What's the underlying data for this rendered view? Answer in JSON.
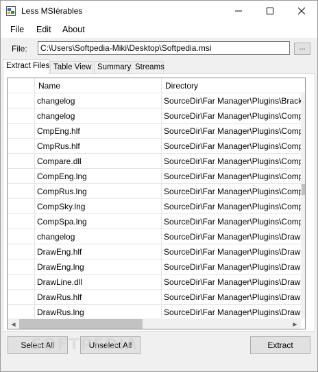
{
  "window": {
    "title": "Less MSIérables",
    "controls": {
      "minimize": "minimize",
      "maximize": "maximize",
      "close": "close"
    }
  },
  "menu": [
    "File",
    "Edit",
    "About"
  ],
  "file": {
    "label": "File:",
    "path": "C:\\Users\\Softpedia-Miki\\Desktop\\Softpedia.msi",
    "browse_label": "..."
  },
  "tabs": [
    "Extract Files",
    "Table View",
    "Summary",
    "Streams"
  ],
  "active_tab": "Extract Files",
  "table": {
    "columns": [
      "",
      "Name",
      "Directory"
    ],
    "rows": [
      {
        "name": "changelog",
        "directory": "SourceDir\\Far Manager\\Plugins\\Brackets"
      },
      {
        "name": "changelog",
        "directory": "SourceDir\\Far Manager\\Plugins\\Compare"
      },
      {
        "name": "CmpEng.hlf",
        "directory": "SourceDir\\Far Manager\\Plugins\\Compare"
      },
      {
        "name": "CmpRus.hlf",
        "directory": "SourceDir\\Far Manager\\Plugins\\Compare"
      },
      {
        "name": "Compare.dll",
        "directory": "SourceDir\\Far Manager\\Plugins\\Compare"
      },
      {
        "name": "CompEng.lng",
        "directory": "SourceDir\\Far Manager\\Plugins\\Compare"
      },
      {
        "name": "CompRus.lng",
        "directory": "SourceDir\\Far Manager\\Plugins\\Compare"
      },
      {
        "name": "CompSky.lng",
        "directory": "SourceDir\\Far Manager\\Plugins\\Compare"
      },
      {
        "name": "CompSpa.lng",
        "directory": "SourceDir\\Far Manager\\Plugins\\Compare"
      },
      {
        "name": "changelog",
        "directory": "SourceDir\\Far Manager\\Plugins\\DrawLine"
      },
      {
        "name": "DrawEng.hlf",
        "directory": "SourceDir\\Far Manager\\Plugins\\DrawLine"
      },
      {
        "name": "DrawEng.lng",
        "directory": "SourceDir\\Far Manager\\Plugins\\DrawLine"
      },
      {
        "name": "DrawLine.dll",
        "directory": "SourceDir\\Far Manager\\Plugins\\DrawLine"
      },
      {
        "name": "DrawRus.hlf",
        "directory": "SourceDir\\Far Manager\\Plugins\\DrawLine"
      },
      {
        "name": "DrawRus.lng",
        "directory": "SourceDir\\Far Manager\\Plugins\\DrawLine"
      }
    ]
  },
  "buttons": {
    "select_all": "Select All",
    "unselect_all": "Unselect All",
    "extract": "Extract"
  },
  "watermark": "SOFTPEDIA",
  "colors": {
    "window_bg": "#f0f0f0",
    "button_bg": "#e1e1e1",
    "grid_line": "#e5e5e5",
    "scroll_thumb": "#c2c2c2"
  }
}
